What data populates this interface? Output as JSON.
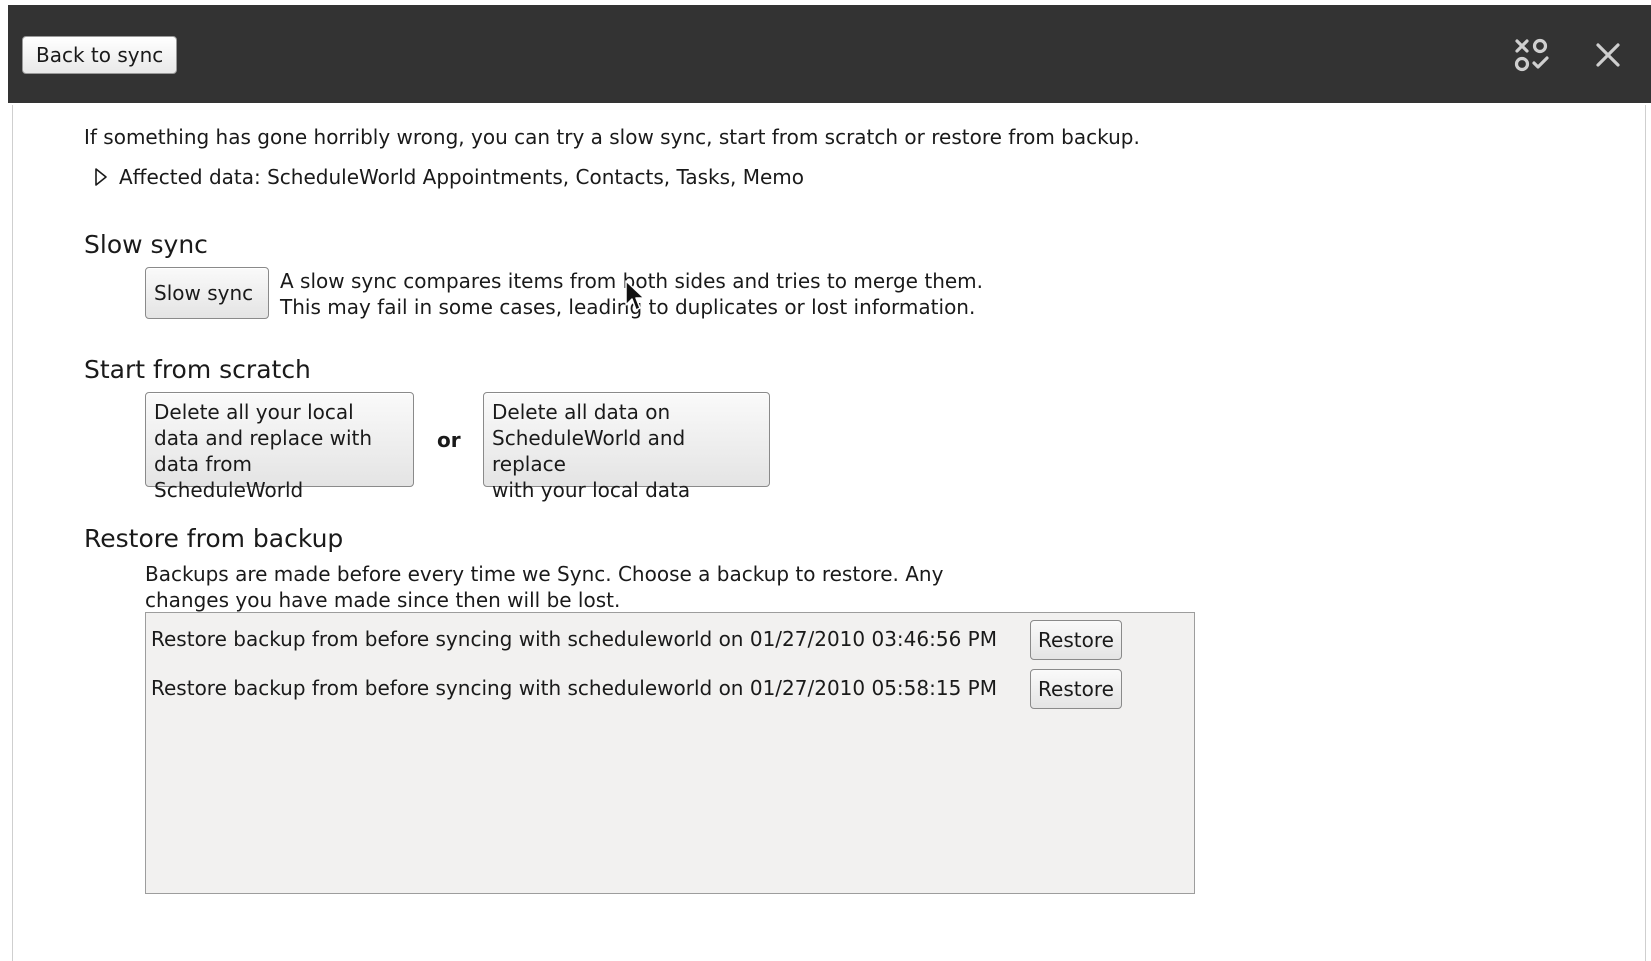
{
  "titlebar": {
    "back_label": "Back to sync",
    "icons": [
      "sort-toggle-icon",
      "close-icon"
    ]
  },
  "intro_text": "If something has gone horribly wrong, you can try a slow sync, start from scratch or restore from backup.",
  "affected": {
    "label": "Affected data: ScheduleWorld Appointments, Contacts, Tasks, Memo",
    "expander_icon": "triangle-right-icon"
  },
  "slow_sync": {
    "heading": "Slow sync",
    "button_label": "Slow sync",
    "description": "A slow sync compares items from both sides and tries to merge them.\nThis may fail in some cases, leading to duplicates or lost information."
  },
  "scratch": {
    "heading": "Start from scratch",
    "local_button_label": "Delete all your local\ndata and replace with\ndata from ScheduleWorld",
    "or_label": "or",
    "remote_button_label": "Delete all data on\nScheduleWorld and replace\nwith your local data"
  },
  "restore": {
    "heading": "Restore from backup",
    "description": "Backups are made before every time we Sync. Choose a backup to restore. Any\nchanges you have made since then will be lost.",
    "backups": [
      {
        "label": "Restore backup from before syncing with scheduleworld on 01/27/2010 03:46:56 PM",
        "button_label": "Restore"
      },
      {
        "label": "Restore backup from before syncing with scheduleworld on 01/27/2010 05:58:15 PM",
        "button_label": "Restore"
      }
    ]
  },
  "colors": {
    "titlebar_bg": "#333333",
    "list_bg": "#f2f1f0",
    "button_border": "#8a8a8a"
  }
}
